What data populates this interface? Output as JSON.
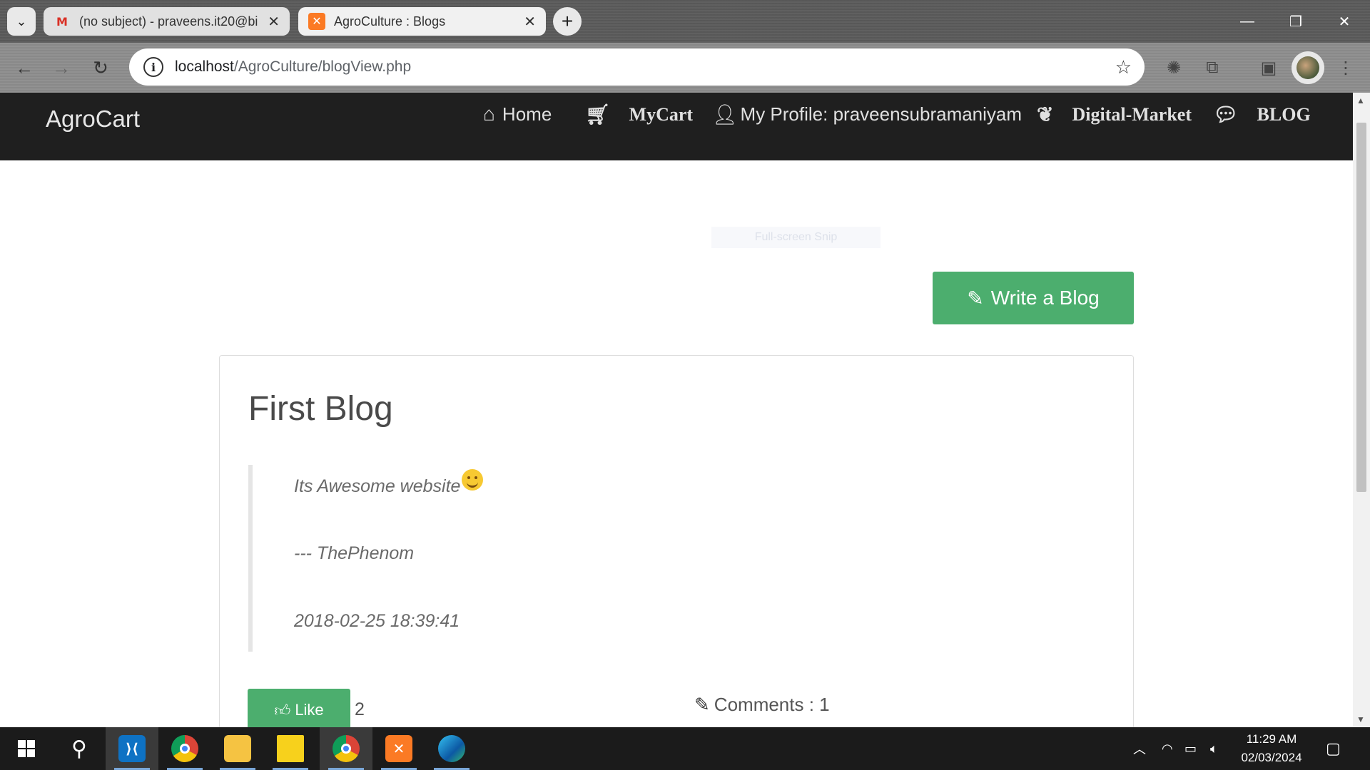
{
  "browser": {
    "tabs": [
      {
        "title": "(no subject) - praveens.it20@bi",
        "favicon": "gmail-icon"
      },
      {
        "title": "AgroCulture : Blogs",
        "favicon": "xampp-icon"
      }
    ],
    "url_host": "localhost",
    "url_path": "/AgroCulture/blogView.php"
  },
  "site": {
    "brand": "AgroCart",
    "nav": {
      "home": "Home",
      "mycart": "MyCart",
      "profile": "My Profile: praveensubramaniyam",
      "market": "Digital-Market",
      "blog": "BLOG"
    },
    "snip_overlay": "Full-screen Snip",
    "write_button": "Write a Blog"
  },
  "blog": {
    "title": "First Blog",
    "content": "Its Awesome website",
    "author": "--- ThePhenom",
    "timestamp": "2018-02-25 18:39:41",
    "like_label": "Like",
    "like_count": "2",
    "comments": "Comments : 1"
  },
  "taskbar": {
    "time": "11:29 AM",
    "date": "02/03/2024"
  },
  "colors": {
    "accent_green": "#4cae6e",
    "navbar": "#1f1f1f"
  }
}
